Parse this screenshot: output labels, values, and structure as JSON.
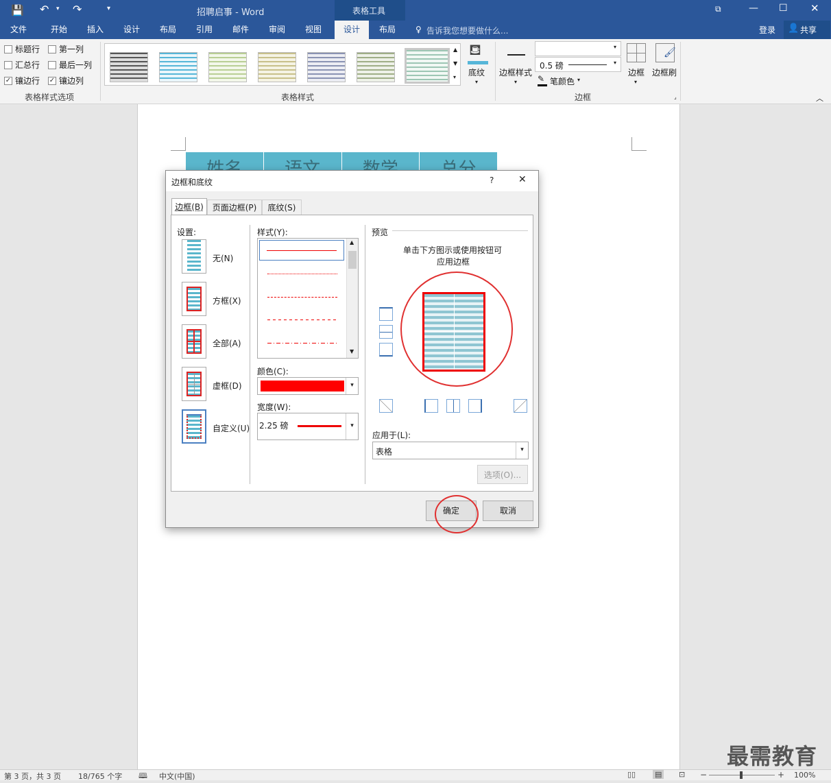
{
  "title_bar": {
    "doc_title": "招聘启事 - Word",
    "context_tab": "表格工具"
  },
  "tabs": [
    "文件",
    "开始",
    "插入",
    "设计",
    "布局",
    "引用",
    "邮件",
    "审阅",
    "视图",
    "设计",
    "布局"
  ],
  "tell_me": "告诉我您想要做什么...",
  "login": "登录",
  "share": "共享",
  "ribbon": {
    "style_options": {
      "header_row": "标题行",
      "first_col": "第一列",
      "total_row": "汇总行",
      "last_col": "最后一列",
      "banded_rows": "镶边行",
      "banded_cols": "镶边列",
      "group_label": "表格样式选项"
    },
    "table_styles_label": "表格样式",
    "shading": "底纹",
    "border_styles": "边框样式",
    "pen_weight": "0.5 磅",
    "pen_color": "笔颜色",
    "borders": "边框",
    "border_painter": "边框刷",
    "borders_group": "边框"
  },
  "table_header": [
    "姓名",
    "语文",
    "数学",
    "总分"
  ],
  "dialog": {
    "title": "边框和底纹",
    "help": "?",
    "close": "✕",
    "tabs": [
      "边框(B)",
      "页面边框(P)",
      "底纹(S)"
    ],
    "settings_label": "设置:",
    "settings": [
      "无(N)",
      "方框(X)",
      "全部(A)",
      "虚框(D)",
      "自定义(U)"
    ],
    "style_label": "样式(Y):",
    "color_label": "颜色(C):",
    "width_label": "宽度(W):",
    "width_value": "2.25 磅",
    "preview_label": "预览",
    "preview_hint_1": "单击下方图示或使用按钮可",
    "preview_hint_2": "应用边框",
    "apply_to_label": "应用于(L):",
    "apply_to_value": "表格",
    "options_button": "选项(O)...",
    "ok": "确定",
    "cancel": "取消",
    "border_color": "#ff0000"
  },
  "status": {
    "page": "第 3 页，共 3 页",
    "words": "18/765 个字",
    "lang": "中文(中国)",
    "zoom": "100%"
  },
  "watermark": "最需教育"
}
